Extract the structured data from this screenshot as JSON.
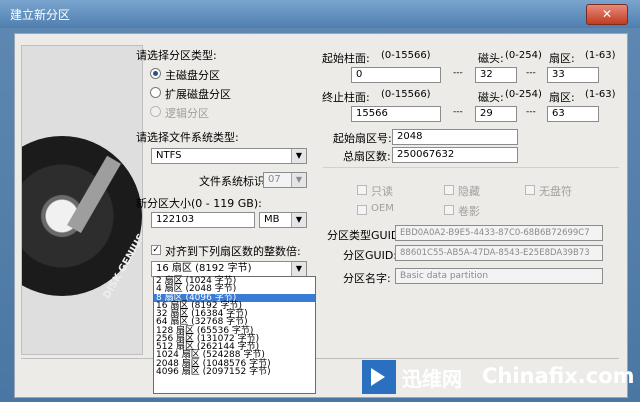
{
  "window": {
    "title": "建立新分区",
    "close_icon": "close-icon"
  },
  "partition_type": {
    "label": "请选择分区类型:",
    "options": [
      {
        "label": "主磁盘分区",
        "selected": true,
        "enabled": true
      },
      {
        "label": "扩展磁盘分区",
        "selected": false,
        "enabled": true
      },
      {
        "label": "逻辑分区",
        "selected": false,
        "enabled": false
      }
    ]
  },
  "filesystem": {
    "label": "请选择文件系统类型:",
    "value": "NTFS",
    "fsid_label": "文件系统标识:",
    "fsid_value": "07"
  },
  "size": {
    "label": "新分区大小(0 - 119 GB):",
    "value": "122103",
    "unit": "MB"
  },
  "align": {
    "label": "对齐到下列扇区数的整数倍:",
    "checked": true,
    "value": "16 扇区  (8192 字节)"
  },
  "align_options": [
    "2 扇区  (1024 字节)",
    "4 扇区  (2048 字节)",
    "8 扇区  (4096 字节)",
    "16 扇区  (8192 字节)",
    "32 扇区  (16384 字节)",
    "64 扇区  (32768 字节)",
    "128 扇区  (65536 字节)",
    "256 扇区  (131072 字节)",
    "512 扇区  (262144 字节)",
    "1024 扇区  (524288 字节)",
    "2048 扇区  (1048576 字节)",
    "4096 扇区  (2097152 字节)"
  ],
  "align_selected_index": 2,
  "geometry": {
    "start_cyl_label": "起始柱面:",
    "start_cyl_range": "(0-15566)",
    "start_cyl": "0",
    "head_label": "磁头:",
    "head_range": "(0-254)",
    "start_head": "32",
    "sector_label": "扇区:",
    "sector_range": "(1-63)",
    "start_sector": "33",
    "end_cyl_label": "终止柱面:",
    "end_cyl_range": "(0-15566)",
    "end_cyl": "15566",
    "end_head": "29",
    "end_sector": "63",
    "dash": "---",
    "start_lba_label": "起始扇区号:",
    "start_lba": "2048",
    "total_sectors_label": "总扇区数:",
    "total_sectors": "250067632"
  },
  "attributes": {
    "readonly": "只读",
    "hidden": "隐藏",
    "noletter": "无盘符",
    "oem": "OEM",
    "shadow": "卷影"
  },
  "guids": {
    "type_label": "分区类型GUID:",
    "type_value": "EBD0A0A2-B9E5-4433-87C0-68B6B72699C7",
    "part_label": "分区GUID:",
    "part_value": "88601C55-AB5A-47DA-8543-E25E8DA39B73",
    "name_label": "分区名字:",
    "name_value": "Basic data partition"
  },
  "watermark": {
    "cn": "迅维网",
    "en": "Chinafix.com",
    "disk_brand": "DISK GENIUS"
  }
}
